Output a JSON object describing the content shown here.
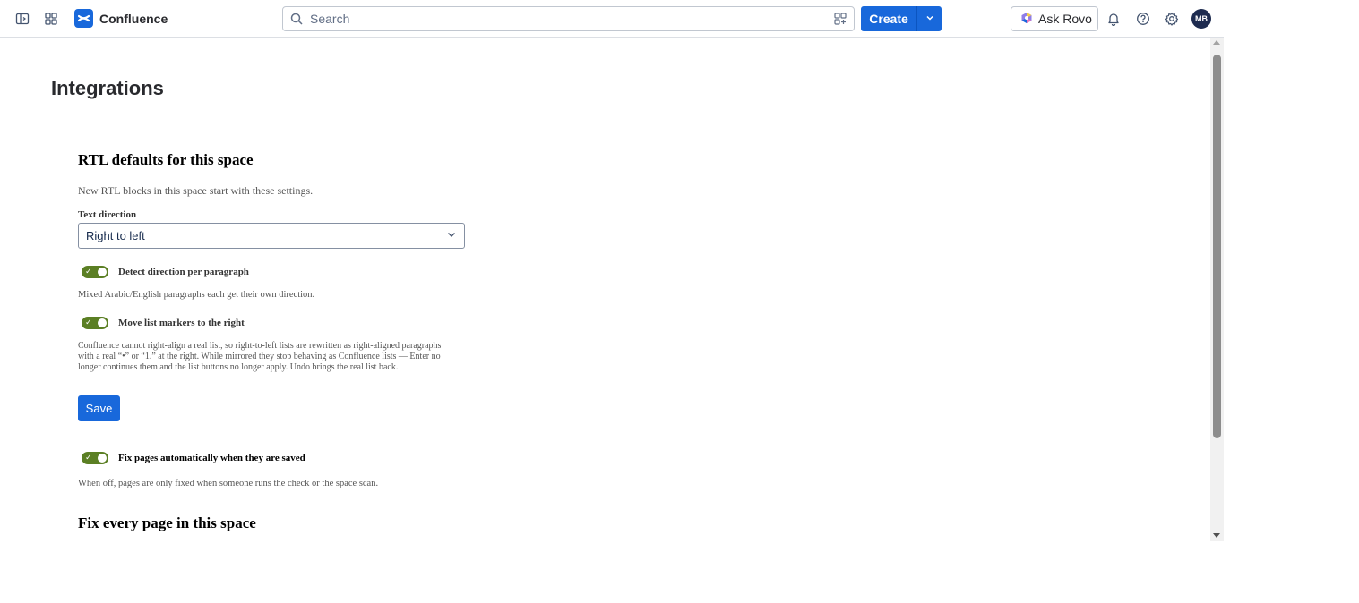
{
  "nav": {
    "app_name": "Confluence",
    "search_placeholder": "Search",
    "create_label": "Create",
    "rovo_label": "Ask Rovo",
    "avatar_initials": "MB",
    "brand_color": "#1868db"
  },
  "page": {
    "title": "Integrations"
  },
  "rtl_defaults": {
    "heading": "RTL defaults for this space",
    "description": "New RTL blocks in this space start with these settings.",
    "text_direction_label": "Text direction",
    "text_direction_value": "Right to left",
    "detect_label": "Detect direction per paragraph",
    "detect_note": "Mixed Arabic/English paragraphs each get their own direction.",
    "detect_enabled": true,
    "list_markers_label": "Move list markers to the right",
    "list_markers_note": "Confluence cannot right-align a real list, so right-to-left lists are rewritten as right-aligned paragraphs with a real “•” or “1.” at the right. While mirrored they stop behaving as Confluence lists — Enter no longer continues them and the list buttons no longer apply. Undo brings the real list back.",
    "list_markers_enabled": true,
    "save_label": "Save"
  },
  "auto_fix": {
    "label": "Fix pages automatically when they are saved",
    "note": "When off, pages are only fixed when someone runs the check or the space scan.",
    "enabled": true,
    "toggle_color": "#5b7f24"
  },
  "fix_all": {
    "heading": "Fix every page in this space"
  }
}
